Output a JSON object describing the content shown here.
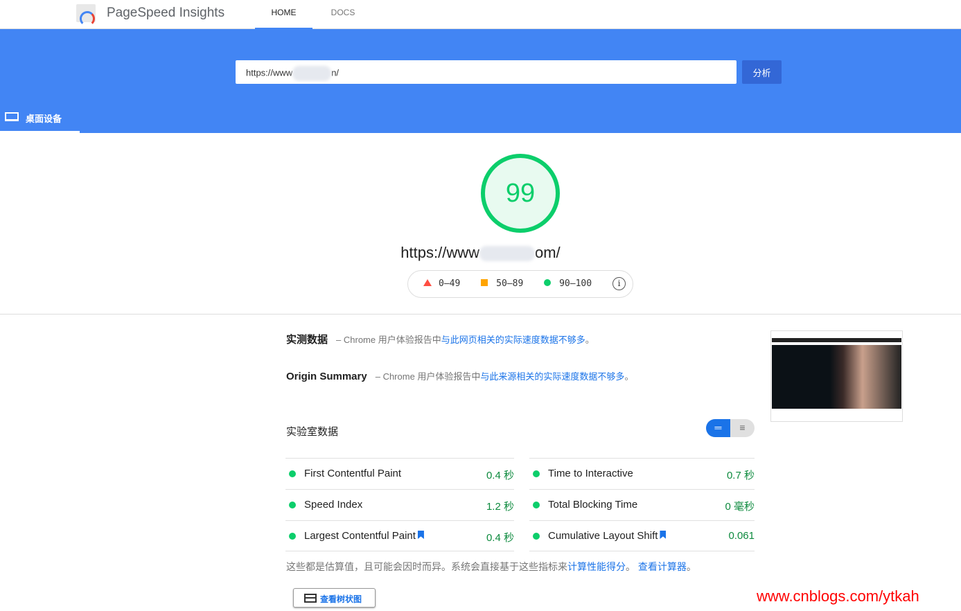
{
  "header": {
    "brand": "PageSpeed Insights",
    "nav": [
      "HOME",
      "DOCS"
    ]
  },
  "search": {
    "url_prefix": "https://www",
    "url_suffix": "n/",
    "analyze_label": "分析"
  },
  "device_tab": {
    "label": "桌面设备",
    "icon": "laptop-icon"
  },
  "score": {
    "value": "99",
    "url_prefix": "https://www",
    "url_suffix": "om/",
    "color": "#0cce6b"
  },
  "legend": {
    "fail": "0–49",
    "average": "50–89",
    "pass": "90–100",
    "info": "i"
  },
  "field": {
    "title": "实测数据",
    "dash": "–",
    "prefix": "Chrome 用户体验报告中",
    "link": "与此网页相关的实际速度数据不够多",
    "end": "。"
  },
  "origin": {
    "title": "Origin Summary",
    "dash": "–",
    "prefix": "Chrome 用户体验报告中",
    "link": "与此来源相关的实际速度数据不够多",
    "end": "。"
  },
  "lab": {
    "title": "实验室数据"
  },
  "metrics": [
    {
      "label": "First Contentful Paint",
      "value": "0.4 秒"
    },
    {
      "label": "Time to Interactive",
      "value": "0.7 秒"
    },
    {
      "label": "Speed Index",
      "value": "1.2 秒"
    },
    {
      "label": "Total Blocking Time",
      "value": "0 毫秒"
    },
    {
      "label": "Largest Contentful Paint",
      "value": "0.4 秒",
      "flag": true
    },
    {
      "label": "Cumulative Layout Shift",
      "value": "0.061",
      "flag": true
    }
  ],
  "note": {
    "text": "这些都是估算值，且可能会因时而异。系统会直接基于这些指标来",
    "link1": "计算性能得分",
    "sep": "。 ",
    "link2": "查看计算器",
    "end": "。"
  },
  "treemap": {
    "label": "查看树状图"
  },
  "watermark": "www.cnblogs.com/ytkah"
}
